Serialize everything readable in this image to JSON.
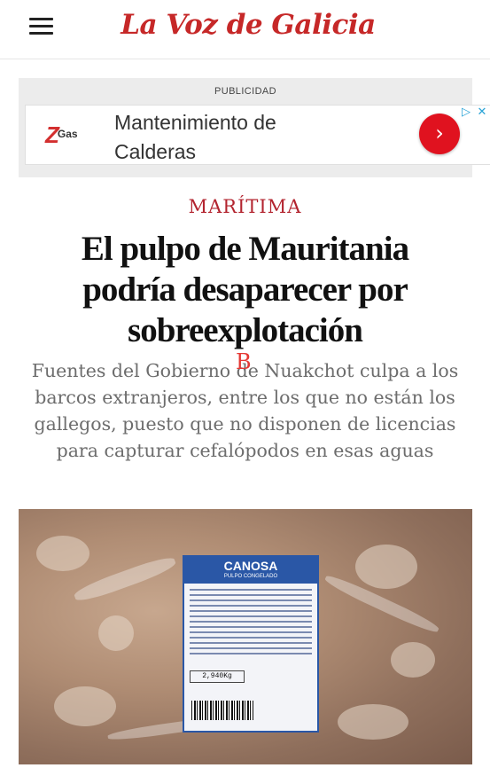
{
  "header": {
    "logo_text": "La Voz de Galicia",
    "menu_icon": "hamburger-menu-icon"
  },
  "ad": {
    "label": "PUBLICIDAD",
    "brand_mark": "Z",
    "brand_text": "Gas",
    "title": "Mantenimiento de Calderas",
    "go_icon": "chevron-right-icon",
    "adchoices_icon": "ad-choices-icon",
    "close_icon": "close-icon"
  },
  "article": {
    "section": "MARÍTIMA",
    "headline": "El pulpo de Mauritania podría desaparecer por sobreexplotación",
    "subtitle": "Fuentes del Gobierno de Nuakchot culpa a los barcos extranjeros, entre los que no están los gallegos, puesto que no disponen de licencias para capturar cefalópodos en esas aguas",
    "overlay_mark": "B"
  },
  "photo": {
    "label_brand": "CANOSA",
    "label_sub": "PULPO CONGELADO",
    "label_weight": "2,940Kg"
  },
  "colors": {
    "brand_red": "#c62828",
    "section_red": "#b3242f",
    "ad_button_red": "#e0121f",
    "label_blue": "#2a57a6"
  }
}
